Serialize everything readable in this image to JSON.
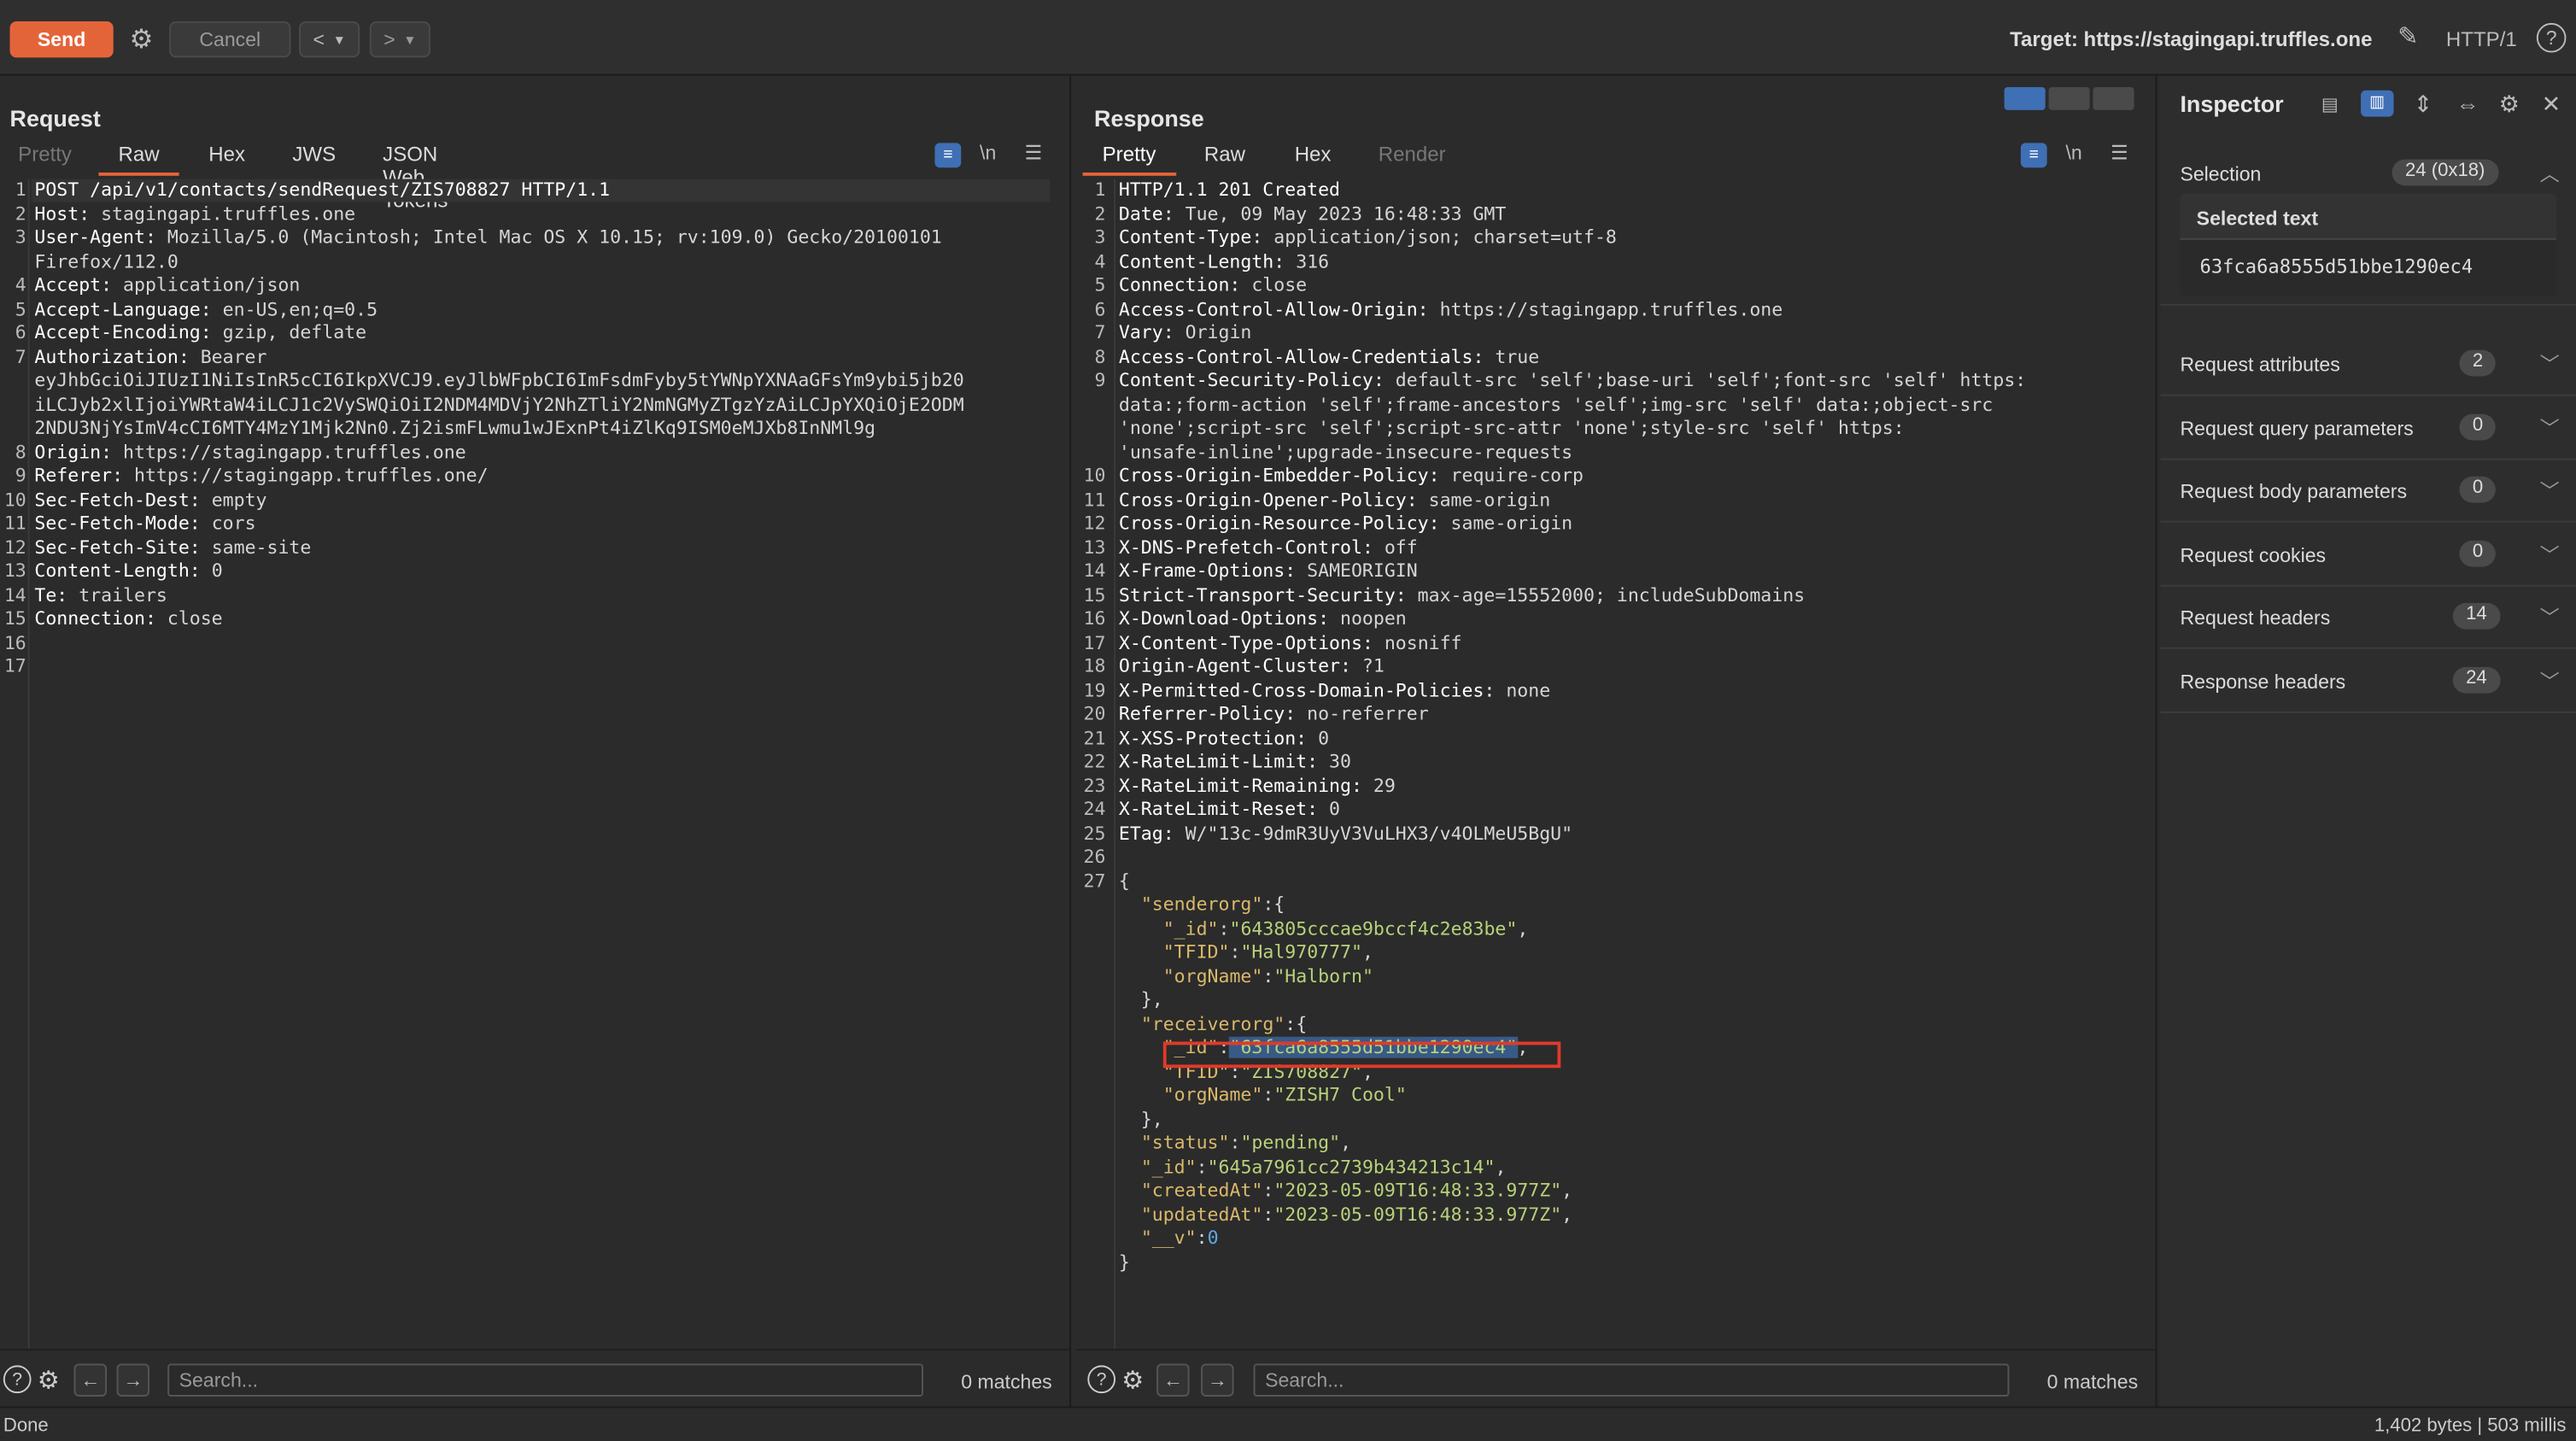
{
  "toolbar": {
    "send_label": "Send",
    "cancel_label": "Cancel",
    "back_label": "<",
    "forward_label": ">",
    "target_text": "Target: https://stagingapi.truffles.one",
    "protocol": "HTTP/1",
    "help_label": "?",
    "accent_color": "#e4643a"
  },
  "request": {
    "title": "Request",
    "tabs": [
      "Pretty",
      "Raw",
      "Hex",
      "JWS",
      "JSON Web Tokens"
    ],
    "active_tab": "Raw",
    "newline_label": "\\n",
    "line_numbers": [
      "1",
      "2",
      "3",
      "",
      "4",
      "5",
      "6",
      "7",
      "",
      "",
      "",
      "8",
      "9",
      "10",
      "11",
      "12",
      "13",
      "14",
      "15",
      "16",
      "17"
    ],
    "lines": [
      "POST /api/v1/contacts/sendRequest/ZIS708827 HTTP/1.1",
      "Host: stagingapi.truffles.one",
      "User-Agent: Mozilla/5.0 (Macintosh; Intel Mac OS X 10.15; rv:109.0) Gecko/20100101",
      "Firefox/112.0",
      "Accept: application/json",
      "Accept-Language: en-US,en;q=0.5",
      "Accept-Encoding: gzip, deflate",
      "Authorization: Bearer",
      "eyJhbGciOiJIUzI1NiIsInR5cCI6IkpXVCJ9.eyJlbWFpbCI6ImFsdmFyby5tYWNpYXNAaGFsYm9ybi5jb20",
      "iLCJyb2xlIjoiYWRtaW4iLCJ1c2VySWQiOiI2NDM4MDVjY2NhZTliY2NmNGMyZTgzYzAiLCJpYXQiOjE2ODM",
      "2NDU3NjYsImV4cCI6MTY4MzY1Mjk2Nn0.Zj2ismFLwmu1wJExnPt4iZlKq9ISM0eMJXb8InNMl9g",
      "Origin: https://stagingapp.truffles.one",
      "Referer: https://stagingapp.truffles.one/",
      "Sec-Fetch-Dest: empty",
      "Sec-Fetch-Mode: cors",
      "Sec-Fetch-Site: same-site",
      "Content-Length: 0",
      "Te: trailers",
      "Connection: close",
      "",
      ""
    ],
    "search_placeholder": "Search...",
    "matches": "0 matches"
  },
  "response": {
    "title": "Response",
    "tabs": [
      "Pretty",
      "Raw",
      "Hex",
      "Render"
    ],
    "active_tab": "Pretty",
    "newline_label": "\\n",
    "line_numbers": [
      "1",
      "2",
      "3",
      "4",
      "5",
      "6",
      "7",
      "8",
      "9",
      "",
      "",
      "",
      "10",
      "11",
      "12",
      "13",
      "14",
      "15",
      "16",
      "17",
      "18",
      "19",
      "20",
      "21",
      "22",
      "23",
      "24",
      "25",
      "26",
      "27",
      "",
      "",
      "",
      "",
      "",
      "",
      "",
      "",
      "",
      "",
      "",
      "",
      "",
      "",
      "",
      "",
      ""
    ],
    "lines": [
      "HTTP/1.1 201 Created",
      "Date: Tue, 09 May 2023 16:48:33 GMT",
      "Content-Type: application/json; charset=utf-8",
      "Content-Length: 316",
      "Connection: close",
      "Access-Control-Allow-Origin: https://stagingapp.truffles.one",
      "Vary: Origin",
      "Access-Control-Allow-Credentials: true",
      "Content-Security-Policy: default-src 'self';base-uri 'self';font-src 'self' https:",
      "data:;form-action 'self';frame-ancestors 'self';img-src 'self' data:;object-src",
      "'none';script-src 'self';script-src-attr 'none';style-src 'self' https:",
      "'unsafe-inline';upgrade-insecure-requests",
      "Cross-Origin-Embedder-Policy: require-corp",
      "Cross-Origin-Opener-Policy: same-origin",
      "Cross-Origin-Resource-Policy: same-origin",
      "X-DNS-Prefetch-Control: off",
      "X-Frame-Options: SAMEORIGIN",
      "Strict-Transport-Security: max-age=15552000; includeSubDomains",
      "X-Download-Options: noopen",
      "X-Content-Type-Options: nosniff",
      "Origin-Agent-Cluster: ?1",
      "X-Permitted-Cross-Domain-Policies: none",
      "Referrer-Policy: no-referrer",
      "X-XSS-Protection: 0",
      "X-RateLimit-Limit: 30",
      "X-RateLimit-Remaining: 29",
      "X-RateLimit-Reset: 0",
      "ETag: W/\"13c-9dmR3UyV3VuLHX3/v4OLMeU5BgU\"",
      "",
      "{",
      "  \"senderorg\":{",
      "    \"_id\":\"643805cccae9bccf4c2e83be\",",
      "    \"TFID\":\"Hal970777\",",
      "    \"orgName\":\"Halborn\"",
      "  },",
      "  \"receiverorg\":{",
      "    \"_id\":\"63fca6a8555d51bbe1290ec4\",",
      "    \"TFID\":\"ZIS708827\",",
      "    \"orgName\":\"ZISH7 Cool\"",
      "  },",
      "  \"status\":\"pending\",",
      "  \"_id\":\"645a7961cc2739b434213c14\",",
      "  \"createdAt\":\"2023-05-09T16:48:33.977Z\",",
      "  \"updatedAt\":\"2023-05-09T16:48:33.977Z\",",
      "  \"__v\":0",
      "}"
    ],
    "search_placeholder": "Search...",
    "matches": "0 matches"
  },
  "inspector": {
    "title": "Inspector",
    "selection_label": "Selection",
    "selection_count": "24 (0x18)",
    "selected_text_label": "Selected text",
    "selected_text_value": "63fca6a8555d51bbe1290ec4",
    "sections": [
      {
        "label": "Request attributes",
        "count": "2"
      },
      {
        "label": "Request query parameters",
        "count": "0"
      },
      {
        "label": "Request body parameters",
        "count": "0"
      },
      {
        "label": "Request cookies",
        "count": "0"
      },
      {
        "label": "Request headers",
        "count": "14"
      },
      {
        "label": "Response headers",
        "count": "24"
      }
    ]
  },
  "statusbar": {
    "left": "Done",
    "right": "1,402 bytes | 503 millis"
  }
}
